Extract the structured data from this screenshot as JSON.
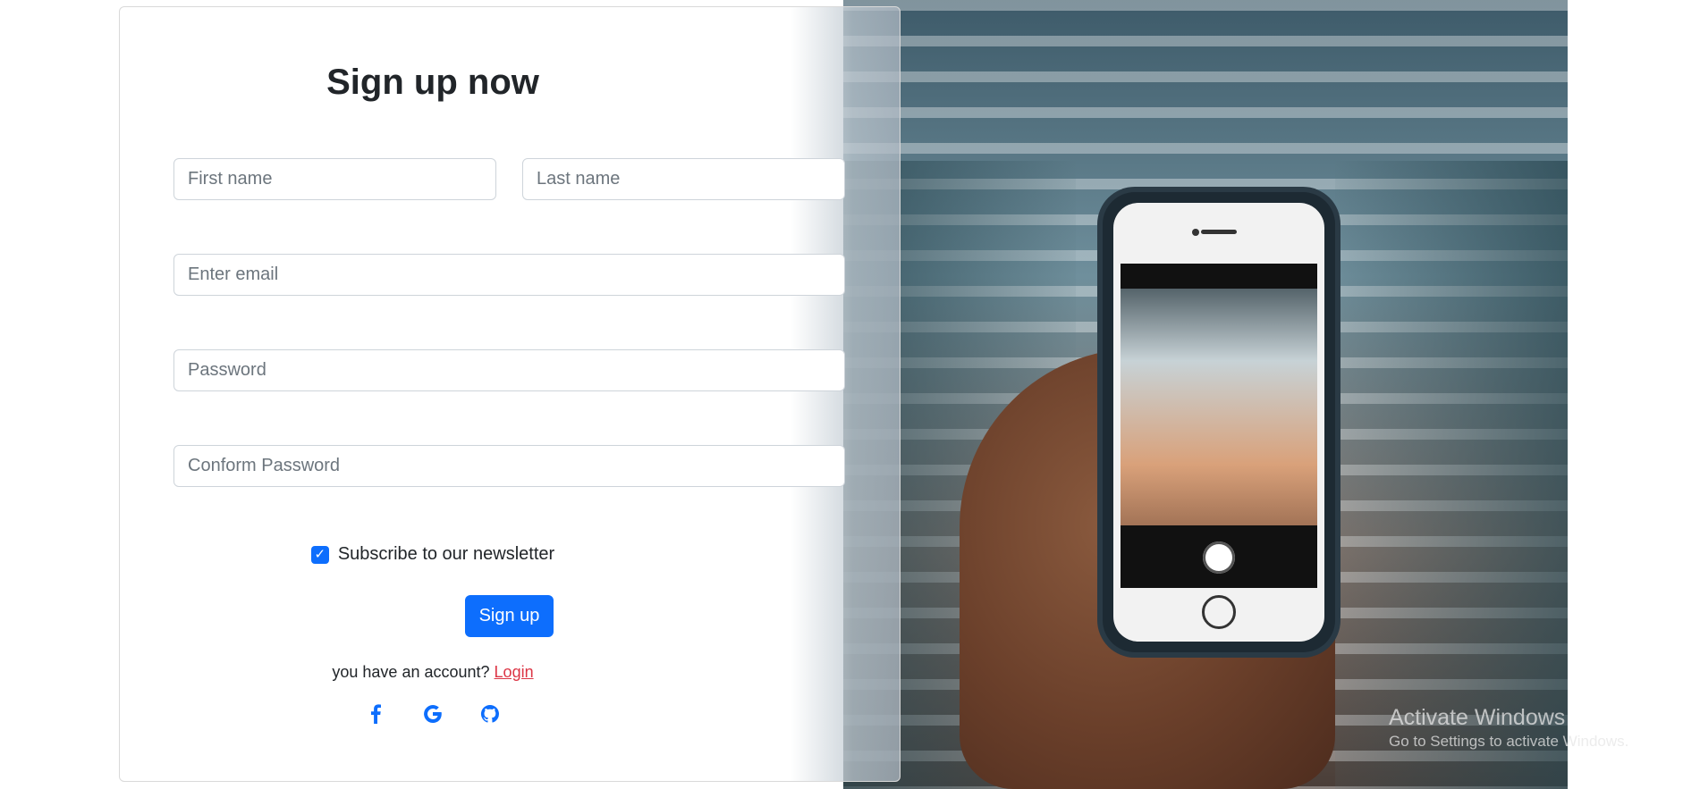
{
  "form": {
    "title": "Sign up now",
    "first_name_placeholder": "First name",
    "last_name_placeholder": "Last name",
    "email_placeholder": "Enter email",
    "password_placeholder": "Password",
    "confirm_placeholder": "Conform Password",
    "newsletter_label": "Subscribe to our newsletter",
    "newsletter_checked": true,
    "signup_label": "Sign up",
    "account_prompt": "you have an account?",
    "login_label": "Login"
  },
  "social": [
    "facebook-icon",
    "google-icon",
    "github-icon"
  ],
  "colors": {
    "primary": "#0d6efd",
    "link": "#dc3545",
    "text": "#212529"
  },
  "watermark": {
    "title": "Activate Windows",
    "subtitle": "Go to Settings to activate Windows."
  }
}
